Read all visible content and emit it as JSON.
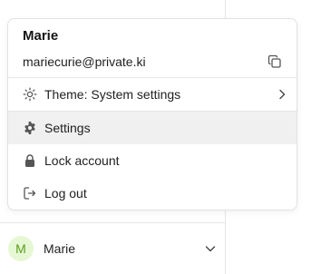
{
  "menu": {
    "user_name": "Marie",
    "email": "mariecurie@private.ki",
    "items": [
      {
        "label": "Theme: System settings",
        "icon": "sun-icon",
        "has_submenu": true
      },
      {
        "label": "Settings",
        "icon": "gear-icon",
        "active": true
      },
      {
        "label": "Lock account",
        "icon": "lock-icon"
      },
      {
        "label": "Log out",
        "icon": "logout-icon"
      }
    ],
    "copy_icon": "copy-icon"
  },
  "user_bar": {
    "avatar_initial": "M",
    "name": "Marie",
    "avatar_bg": "#e6f7d4",
    "avatar_fg": "#5a9e1a"
  }
}
